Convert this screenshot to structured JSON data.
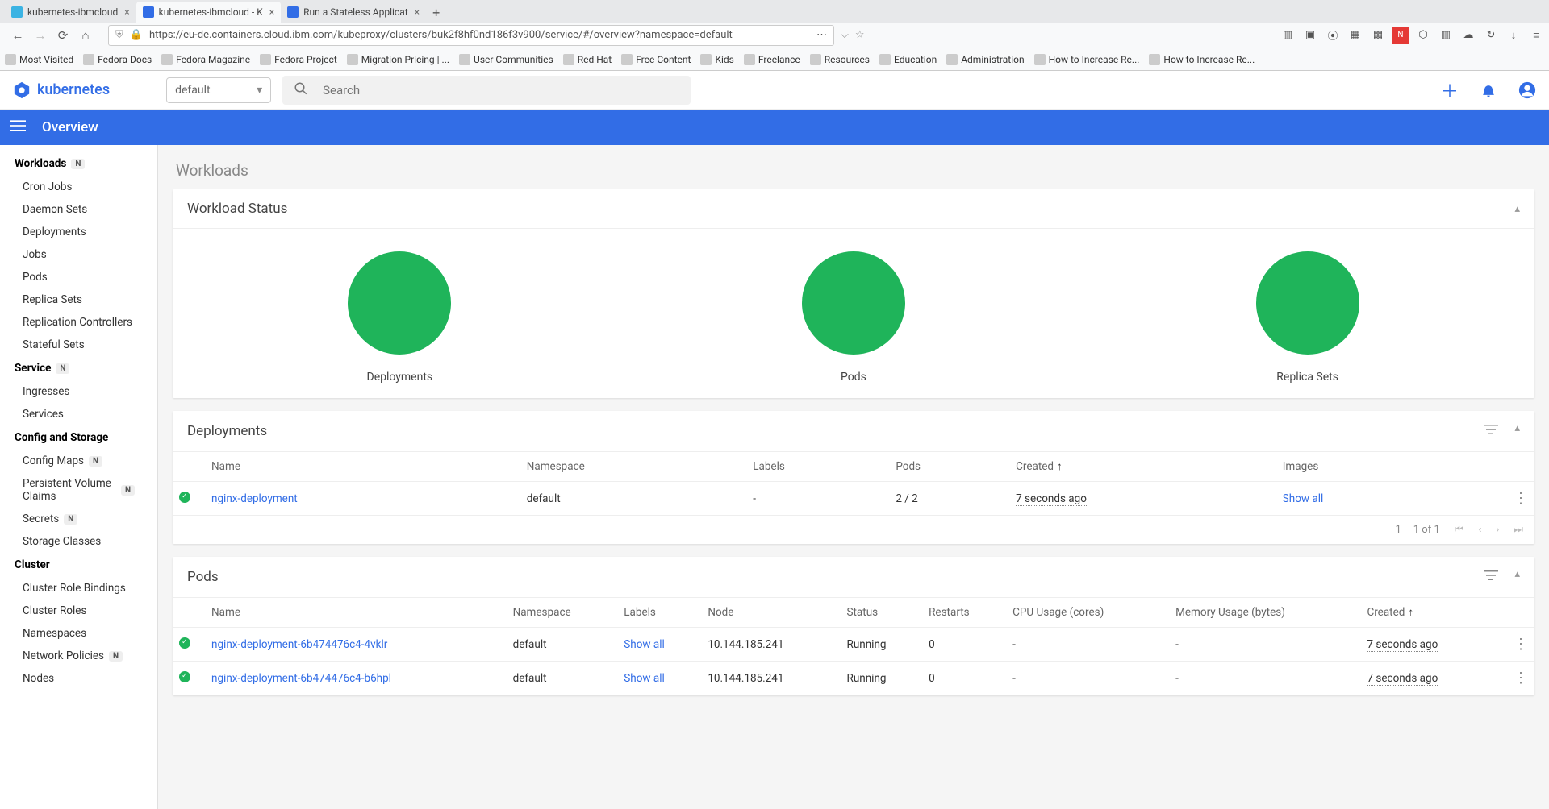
{
  "browser": {
    "tabs": [
      {
        "title": "kubernetes-ibmcloud",
        "active": false,
        "color": "#3bb3e3"
      },
      {
        "title": "kubernetes-ibmcloud - K",
        "active": true,
        "color": "#326de6"
      },
      {
        "title": "Run a Stateless Applicat",
        "active": false,
        "color": "#326de6"
      }
    ],
    "url": "https://eu-de.containers.cloud.ibm.com/kubeproxy/clusters/buk2f8hf0nd186f3v900/service/#/overview?namespace=default",
    "bookmarks": [
      "Most Visited",
      "Fedora Docs",
      "Fedora Magazine",
      "Fedora Project",
      "Migration Pricing | ...",
      "User Communities",
      "Red Hat",
      "Free Content",
      "Kids",
      "Freelance",
      "Resources",
      "Education",
      "Administration",
      "How to Increase Re...",
      "How to Increase Re..."
    ]
  },
  "topbar": {
    "logo": "kubernetes",
    "namespace": "default",
    "search_placeholder": "Search"
  },
  "bluebar": {
    "title": "Overview"
  },
  "sidebar": {
    "sections": [
      {
        "header": "Workloads",
        "hbadge": "N",
        "items": [
          {
            "label": "Cron Jobs"
          },
          {
            "label": "Daemon Sets"
          },
          {
            "label": "Deployments"
          },
          {
            "label": "Jobs"
          },
          {
            "label": "Pods"
          },
          {
            "label": "Replica Sets"
          },
          {
            "label": "Replication Controllers"
          },
          {
            "label": "Stateful Sets"
          }
        ]
      },
      {
        "header": "Service",
        "hbadge": "N",
        "items": [
          {
            "label": "Ingresses"
          },
          {
            "label": "Services"
          }
        ]
      },
      {
        "header": "Config and Storage",
        "items": [
          {
            "label": "Config Maps",
            "badge": "N"
          },
          {
            "label": "Persistent Volume Claims",
            "badge": "N"
          },
          {
            "label": "Secrets",
            "badge": "N"
          },
          {
            "label": "Storage Classes"
          }
        ]
      },
      {
        "header": "Cluster",
        "items": [
          {
            "label": "Cluster Role Bindings"
          },
          {
            "label": "Cluster Roles"
          },
          {
            "label": "Namespaces"
          },
          {
            "label": "Network Policies",
            "badge": "N"
          },
          {
            "label": "Nodes"
          }
        ]
      }
    ]
  },
  "page": {
    "title": "Workloads",
    "workload_status": {
      "title": "Workload Status",
      "donuts": [
        {
          "label": "Deployments"
        },
        {
          "label": "Pods"
        },
        {
          "label": "Replica Sets"
        }
      ]
    },
    "deployments": {
      "title": "Deployments",
      "columns": [
        "",
        "Name",
        "Namespace",
        "Labels",
        "Pods",
        "Created",
        "Images",
        ""
      ],
      "rows": [
        {
          "name": "nginx-deployment",
          "namespace": "default",
          "labels": "-",
          "pods": "2 / 2",
          "created": "7 seconds ago",
          "images": "Show all"
        }
      ],
      "pager": {
        "text": "1 – 1 of 1"
      }
    },
    "pods": {
      "title": "Pods",
      "columns": [
        "",
        "Name",
        "Namespace",
        "Labels",
        "Node",
        "Status",
        "Restarts",
        "CPU Usage (cores)",
        "Memory Usage (bytes)",
        "Created",
        ""
      ],
      "rows": [
        {
          "name": "nginx-deployment-6b474476c4-4vklr",
          "namespace": "default",
          "labels": "Show all",
          "node": "10.144.185.241",
          "status": "Running",
          "restarts": "0",
          "cpu": "-",
          "mem": "-",
          "created": "7 seconds ago"
        },
        {
          "name": "nginx-deployment-6b474476c4-b6hpl",
          "namespace": "default",
          "labels": "Show all",
          "node": "10.144.185.241",
          "status": "Running",
          "restarts": "0",
          "cpu": "-",
          "mem": "-",
          "created": "7 seconds ago"
        }
      ]
    }
  },
  "chart_data": {
    "type": "pie",
    "series": [
      {
        "name": "Deployments",
        "slices": [
          {
            "label": "Running",
            "value": 1,
            "color": "#1fb45a"
          }
        ],
        "total": 1
      },
      {
        "name": "Pods",
        "slices": [
          {
            "label": "Running",
            "value": 2,
            "color": "#1fb45a"
          }
        ],
        "total": 2
      },
      {
        "name": "Replica Sets",
        "slices": [
          {
            "label": "Running",
            "value": 1,
            "color": "#1fb45a"
          }
        ],
        "total": 1
      }
    ],
    "title": "Workload Status"
  }
}
